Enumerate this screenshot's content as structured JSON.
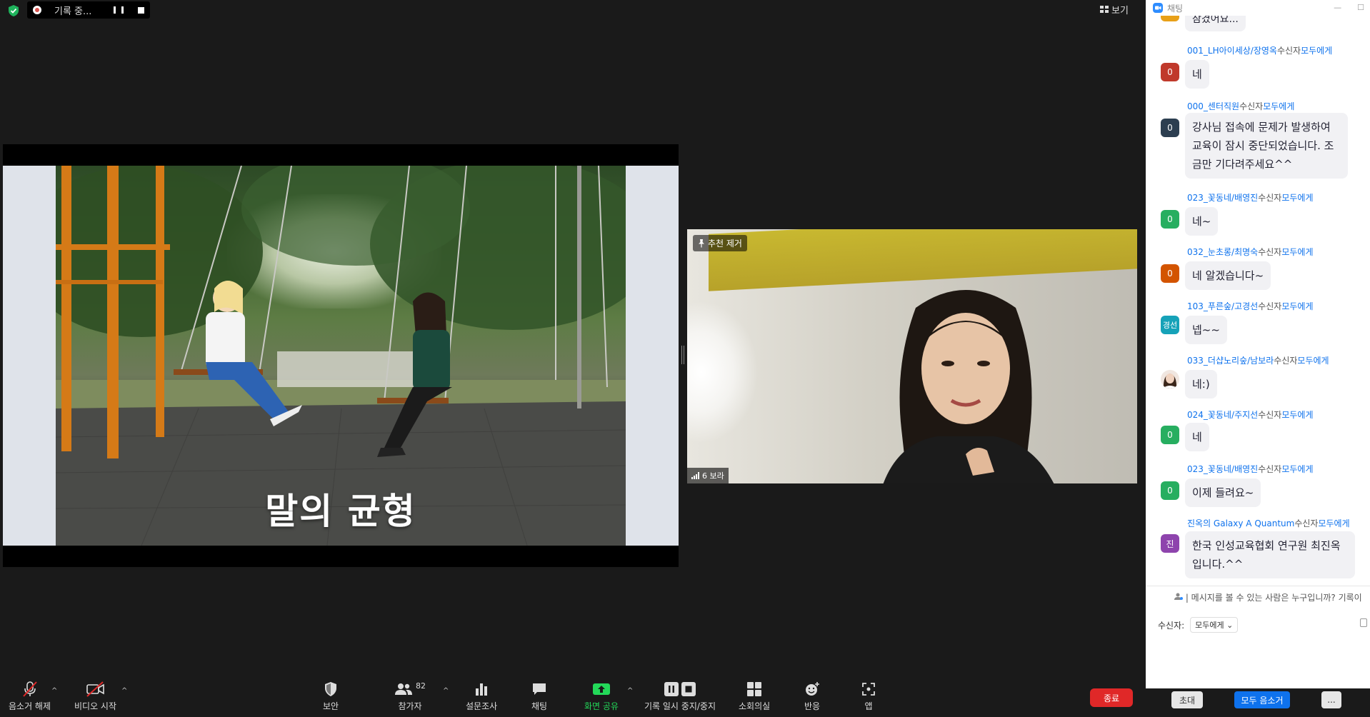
{
  "recording": {
    "label": "기록 중..."
  },
  "view_label": "보기",
  "slide": {
    "title": "말의 균형"
  },
  "video": {
    "unpin_label": "추천 제거",
    "name": "6 보라"
  },
  "toolbar": {
    "unmute": "음소거 해제",
    "video": "비디오 시작",
    "security": "보안",
    "participants": "참가자",
    "participant_count": "82",
    "polls": "설문조사",
    "chat": "채팅",
    "share": "화면 공유",
    "record": "기록 일시 중지/중지",
    "breakout": "소회의실",
    "reactions": "반응",
    "apps": "앱",
    "end": "종료"
  },
  "colors": {
    "share_green": "#23d959",
    "end_red": "#e02828",
    "link_blue": "#0e72ed"
  },
  "chat": {
    "title": "채팅",
    "partial_top": "잠겼어요...",
    "to_label": "수신자",
    "everyone": "모두에게",
    "messages": [
      {
        "sender": "001_LH아이세상/장영옥",
        "avatar": "0",
        "color": "#c0392b",
        "text": "네"
      },
      {
        "sender": "000_센터직원",
        "avatar": "0",
        "color": "#2c3e50",
        "text": "강사님 접속에 문제가 발생하여 교육이 잠시 중단되었습니다. 조금만 기다려주세요^^"
      },
      {
        "sender": "023_꽃동네/배영진",
        "avatar": "0",
        "color": "#27ae60",
        "text": "네~"
      },
      {
        "sender": "032_눈초롱/최명숙",
        "avatar": "0",
        "color": "#d35400",
        "text": "네 알겠습니다~"
      },
      {
        "sender": "103_푸른숲/고경선",
        "avatar": "경선",
        "color": "#16a2b8",
        "text": "넵~~"
      },
      {
        "sender": "033_더샵노리숲/남보라",
        "avatar": "photo",
        "color": "#8a5a44",
        "text": "네:)"
      },
      {
        "sender": "024_꽃동네/주지선",
        "avatar": "0",
        "color": "#27ae60",
        "text": "네"
      },
      {
        "sender": "023_꽃동네/배영진",
        "avatar": "0",
        "color": "#27ae60",
        "text": "이제 들려요~"
      },
      {
        "sender": "진옥의 Galaxy A Quantum",
        "avatar": "진",
        "color": "#8e44ad",
        "text": "한국 인성교육협회 연구원 최진옥입니다.^^"
      }
    ],
    "notice": "| 메시지를 볼 수 있는 사람은 누구입니까? 기록이",
    "recipient_label": "수신자:",
    "recipient_value": "모두에게",
    "bottom": {
      "invite": "초대",
      "mute_all": "모두 음소거"
    }
  }
}
